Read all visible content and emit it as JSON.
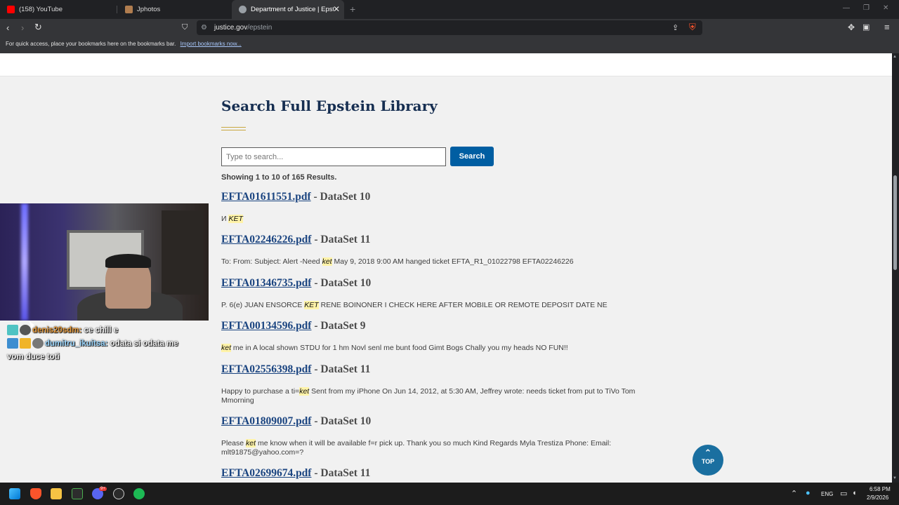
{
  "browser": {
    "tabs": [
      {
        "title": "(158) YouTube",
        "color": "#ff0000"
      },
      {
        "title": "Jphotos",
        "color": "#b07d4f"
      },
      {
        "title": "Department of Justice | Epstein L",
        "color": "#9aa0a6"
      }
    ],
    "new_tab": "+",
    "url": {
      "host": "justice.gov",
      "path": "/epstein"
    },
    "bookmarks_bar": {
      "text": "For quick access, place your bookmarks here on the bookmarks bar.",
      "link": "Import bookmarks now..."
    }
  },
  "page": {
    "heading": "Search Full Epstein Library",
    "search": {
      "placeholder": "Type to search...",
      "value": "",
      "button": "Search"
    },
    "results_summary": "Showing 1 to 10 of 165 Results.",
    "results": [
      {
        "file": "EFTA01611551.pdf",
        "dataset": " - DataSet 10",
        "pre": "И ",
        "hl": "KET",
        "post": ""
      },
      {
        "file": "EFTA02246226.pdf",
        "dataset": " - DataSet 11",
        "pre": "To: From: Subject: Alert -Need ",
        "hl": "ket",
        "post": " May 9, 2018 9:00 AM hanged ticket EFTA_R1_01022798 EFTA02246226"
      },
      {
        "file": "EFTA01346735.pdf",
        "dataset": " - DataSet 10",
        "pre": "P. 6(e) JUAN ENSORCE ",
        "hl": "KET",
        "post": " RENE BOINONER I CHECK HERE AFTER MOBILE OR REMOTE DEPOSIT DATE NE"
      },
      {
        "file": "EFTA00134596.pdf",
        "dataset": " - DataSet 9",
        "pre": "",
        "hl": "ket",
        "post": " me in A local shown STDU for 1 hm Novl senl me bunt food Gimt Bogs Chally you my heads NO FUN!!"
      },
      {
        "file": "EFTA02556398.pdf",
        "dataset": " - DataSet 11",
        "pre": "Happy to purchase a ti=",
        "hl": "ket",
        "post": " Sent from my iPhone On Jun 14, 2012, at 5:30 AM, Jeffrey wrote: needs ticket from put to TiVo Tom Mmorning"
      },
      {
        "file": "EFTA01809007.pdf",
        "dataset": " - DataSet 10",
        "pre": "Please ",
        "hl": "ket",
        "post": " me know when it will be available f=r pick up. Thank you so much Kind Regards Myla Trestiza Phone: Email: mlt91875@yahoo.com=?"
      },
      {
        "file": "EFTA02699674.pdf",
        "dataset": " - DataSet 11",
        "pre": "",
        "hl": "",
        "post": ""
      }
    ],
    "top_button": "TOP"
  },
  "stream_overlay": {
    "chat": [
      {
        "user": "denis20sdm:",
        "message": " ce chill e"
      },
      {
        "user": "dumitru_ikuitsa:",
        "message": " odata si odata me vom duce toti"
      }
    ]
  },
  "taskbar": {
    "language": "ENG",
    "time": "6:58 PM",
    "date": "2/9/2026",
    "discord_badge": "9+"
  }
}
